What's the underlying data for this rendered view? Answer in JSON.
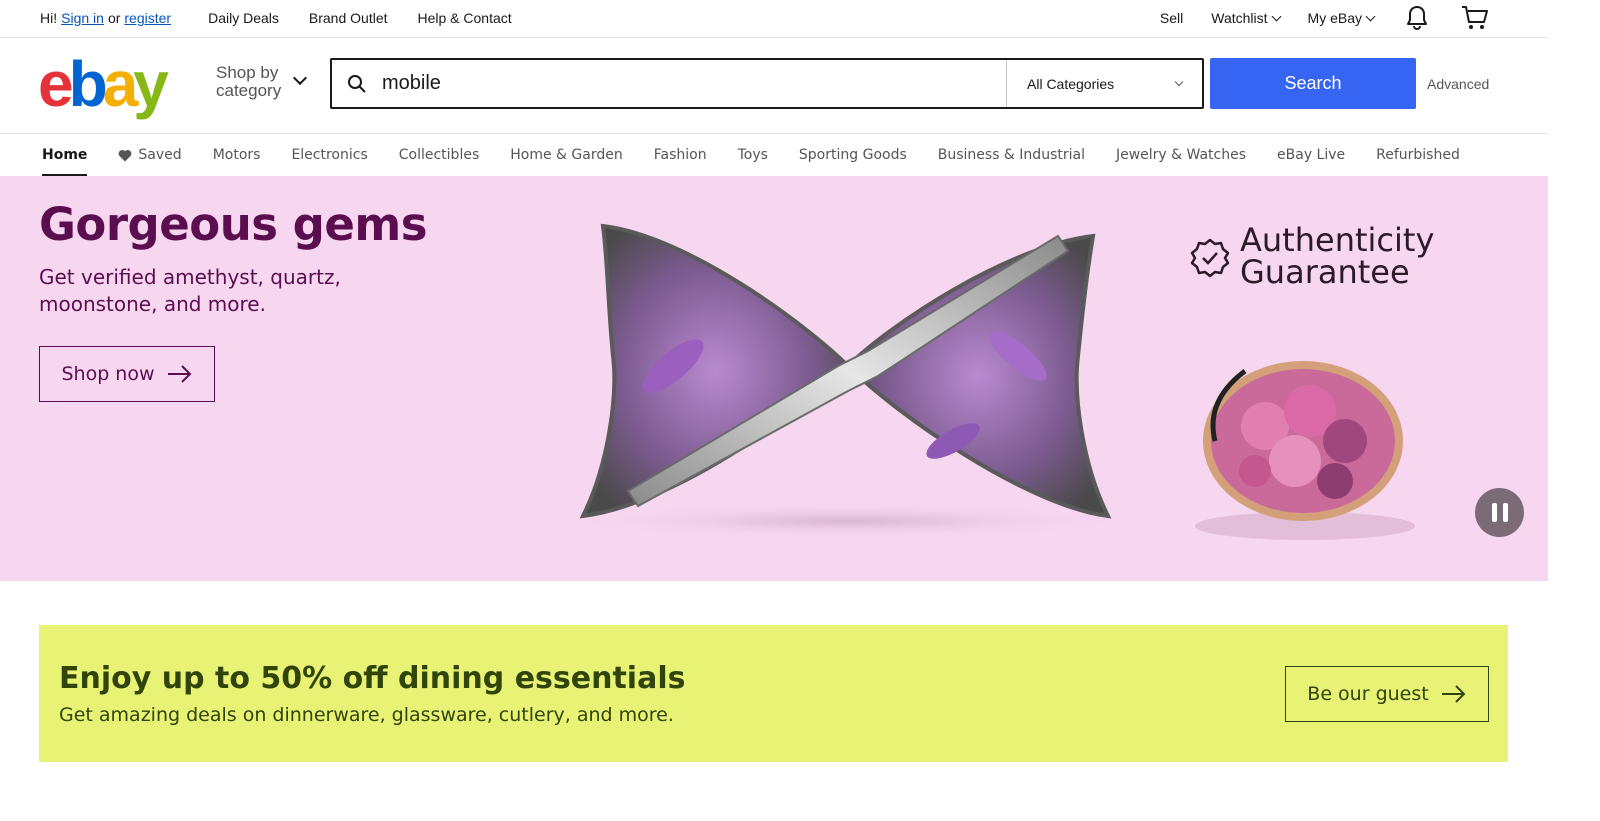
{
  "topbar": {
    "greeting": "Hi!",
    "sign_in": "Sign in",
    "or": "or",
    "register": "register",
    "daily_deals": "Daily Deals",
    "brand_outlet": "Brand Outlet",
    "help_contact": "Help & Contact",
    "sell": "Sell",
    "watchlist": "Watchlist",
    "my_ebay": "My eBay"
  },
  "header": {
    "logo": {
      "e": "e",
      "b": "b",
      "a": "a",
      "y": "y"
    },
    "shop_by_line1": "Shop by",
    "shop_by_line2": "category",
    "search_value": "mobile",
    "category_select": "All Categories",
    "search_button": "Search",
    "advanced": "Advanced"
  },
  "nav": {
    "items": [
      "Home",
      "Saved",
      "Motors",
      "Electronics",
      "Collectibles",
      "Home & Garden",
      "Fashion",
      "Toys",
      "Sporting Goods",
      "Business & Industrial",
      "Jewelry & Watches",
      "eBay Live",
      "Refurbished"
    ]
  },
  "hero": {
    "title": "Gorgeous gems",
    "subtitle": "Get verified amethyst, quartz, moonstone, and more.",
    "cta": "Shop now",
    "badge_line1": "Authenticity",
    "badge_line2": "Guarantee",
    "bg_color": "#f7d6ef",
    "text_color": "#5b0e4f"
  },
  "promo": {
    "title": "Enjoy up to 50% off dining essentials",
    "subtitle": "Get amazing deals on dinnerware, glassware, cutlery, and more.",
    "cta": "Be our guest",
    "bg_color": "#e8f376"
  },
  "icons": [
    "search-icon",
    "bell-icon",
    "cart-icon",
    "heart-icon",
    "chevron-down-icon",
    "arrow-right-icon",
    "check-badge-icon",
    "pause-icon"
  ]
}
